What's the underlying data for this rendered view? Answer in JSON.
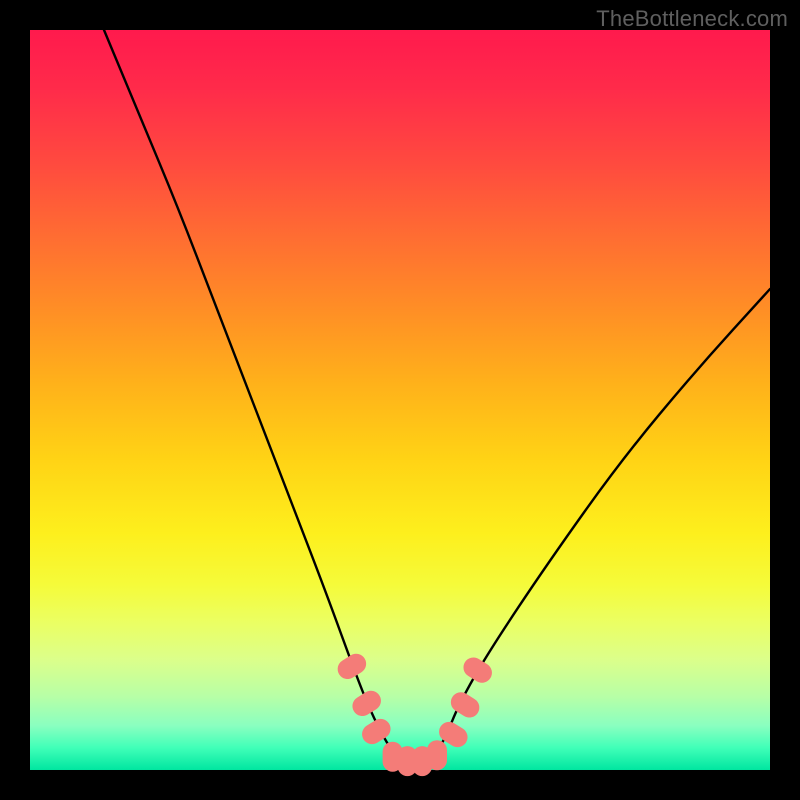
{
  "watermark": "TheBottleneck.com",
  "chart_data": {
    "type": "line",
    "title": "",
    "xlabel": "",
    "ylabel": "",
    "xlim": [
      0,
      100
    ],
    "ylim": [
      0,
      100
    ],
    "note": "Axes have no tick labels; y and x are in percent of plot area. Curve represents a bottleneck/compatibility function with a flat minimum around x≈50.",
    "series": [
      {
        "name": "bottleneck-curve",
        "x": [
          10,
          15,
          20,
          25,
          30,
          35,
          40,
          44,
          46,
          48,
          50,
          52,
          54,
          56,
          58,
          62,
          70,
          80,
          90,
          100
        ],
        "y": [
          100,
          88,
          76,
          63,
          50,
          37,
          24,
          13,
          8,
          4,
          1,
          0,
          1,
          4,
          9,
          16,
          28,
          42,
          54,
          65
        ]
      }
    ],
    "markers": {
      "name": "highlight-nodes",
      "color": "#f47c78",
      "points": [
        {
          "x": 43.5,
          "y": 14.0
        },
        {
          "x": 45.5,
          "y": 9.0
        },
        {
          "x": 46.8,
          "y": 5.2
        },
        {
          "x": 49.0,
          "y": 1.8
        },
        {
          "x": 51.0,
          "y": 1.2
        },
        {
          "x": 53.0,
          "y": 1.2
        },
        {
          "x": 55.0,
          "y": 2.0
        },
        {
          "x": 57.2,
          "y": 4.8
        },
        {
          "x": 58.8,
          "y": 8.8
        },
        {
          "x": 60.5,
          "y": 13.5
        }
      ]
    },
    "colors": {
      "curve": "#000000",
      "gradient_top": "#ff1a4d",
      "gradient_bottom": "#00e6a0"
    }
  }
}
